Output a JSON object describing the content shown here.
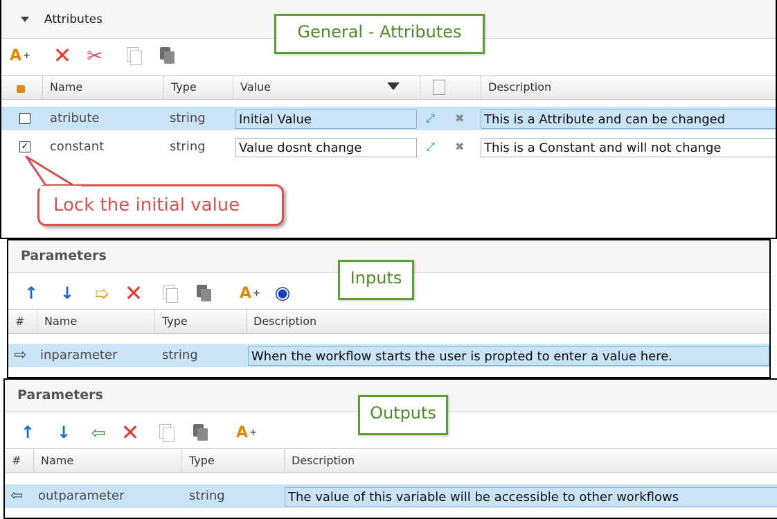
{
  "attributes": {
    "section_title": "Attributes",
    "callout": "General - Attributes",
    "headers": {
      "name": "Name",
      "type": "Type",
      "value": "Value",
      "description": "Description"
    },
    "rows": [
      {
        "checked": false,
        "name": "atribute",
        "type": "string",
        "value": "Initial Value",
        "description": "This is a Attribute and can be changed"
      },
      {
        "checked": true,
        "name": "constant",
        "type": "string",
        "value": "Value dosnt change",
        "description": "This is a Constant and will not change"
      }
    ],
    "balloon": "Lock the initial value"
  },
  "inputs": {
    "section_title": "Parameters",
    "callout": "Inputs",
    "headers": {
      "num": "#",
      "name": "Name",
      "type": "Type",
      "description": "Description"
    },
    "rows": [
      {
        "name": "inparameter",
        "type": "string",
        "description": "When the workflow starts the user is propted to enter a value here."
      }
    ]
  },
  "outputs": {
    "section_title": "Parameters",
    "callout": "Outputs",
    "headers": {
      "num": "#",
      "name": "Name",
      "type": "Type",
      "description": "Description"
    },
    "rows": [
      {
        "name": "outparameter",
        "type": "string",
        "description": "The value of this variable will be accessible to other workflows"
      }
    ]
  },
  "colors": {
    "selected_row": "#c9e3f7",
    "callout_border": "#5ba030",
    "balloon_border": "#d65050",
    "delete": "#e53a2f"
  }
}
